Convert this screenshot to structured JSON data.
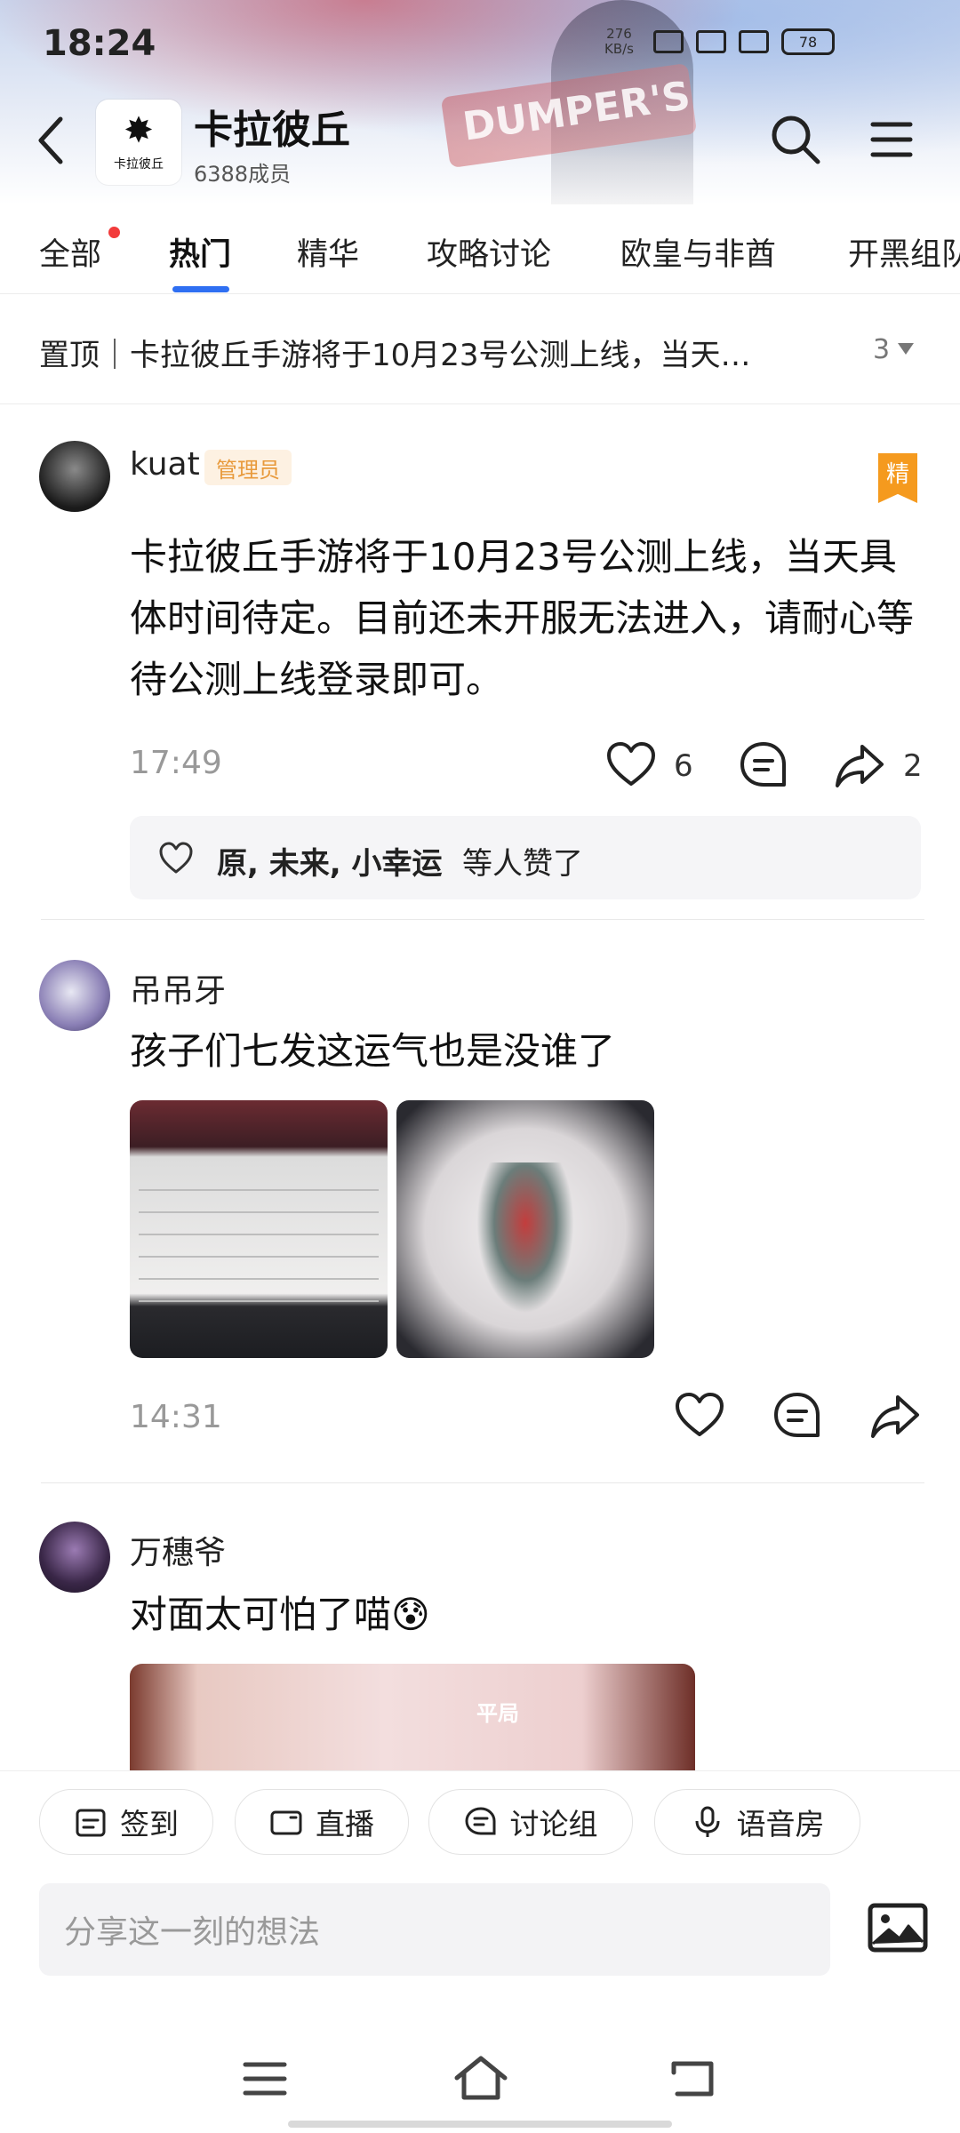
{
  "status_bar": {
    "time": "18:24",
    "net_speed_value": "276",
    "net_speed_unit": "KB/s",
    "battery": "78"
  },
  "header": {
    "banner_sign": "DUMPER'S",
    "logo_text": "卡拉彼丘",
    "group_name": "卡拉彼丘",
    "members": "6388成员"
  },
  "tabs": [
    {
      "label": "全部"
    },
    {
      "label": "热门"
    },
    {
      "label": "精华"
    },
    {
      "label": "攻略讨论"
    },
    {
      "label": "欧皇与非酋"
    },
    {
      "label": "开黑组队"
    }
  ],
  "pinned": {
    "text": "置顶｜卡拉彼丘手游将于10月23号公测上线，当天…",
    "count": "3"
  },
  "posts": [
    {
      "user": "kuat",
      "badge": "管理员",
      "tag": "精",
      "content": "卡拉彼丘手游将于10月23号公测上线，当天具体时间待定。目前还未开服无法进入，请耐心等待公测上线登录即可。",
      "time": "17:49",
      "likes": "6",
      "shares": "2",
      "liked_by": "原, 未来, 小幸运",
      "liked_suffix": "等人赞了"
    },
    {
      "user": "吊吊牙",
      "content": "孩子们七发这运气也是没谁了",
      "time": "14:31"
    },
    {
      "user": "万穗爷",
      "content": "对面太可怕了喵😰",
      "image_label": "平局"
    }
  ],
  "bottom_bar": {
    "chips": [
      {
        "label": "签到"
      },
      {
        "label": "直播"
      },
      {
        "label": "讨论组"
      },
      {
        "label": "语音房"
      }
    ],
    "input_placeholder": "分享这一刻的想法"
  },
  "colors": {
    "accent": "#2f6ff2",
    "badge_text": "#e89a3c",
    "badge_bg": "#fdf1e2",
    "jing_badge": "#f59a1e",
    "notify_dot": "#f23b3b"
  }
}
